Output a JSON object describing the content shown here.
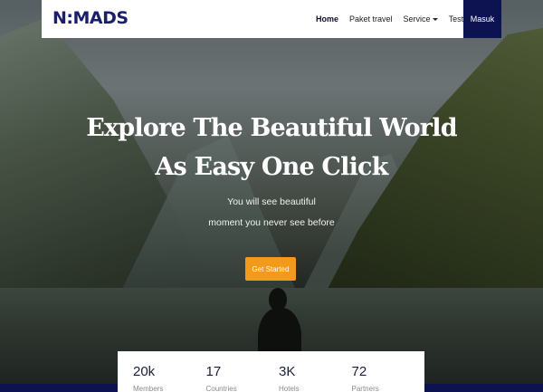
{
  "brand": {
    "logo_text": "N:MADS"
  },
  "nav": {
    "items": [
      {
        "label": "Home",
        "active": true
      },
      {
        "label": "Paket travel",
        "active": false
      },
      {
        "label": "Service",
        "active": false,
        "has_dropdown": true
      },
      {
        "label": "Testimonial",
        "active": false
      }
    ],
    "login_label": "Masuk"
  },
  "hero": {
    "headline_line1": "Explore The Beautiful World",
    "headline_line2": "As Easy One Click",
    "sub_line1": "You will see beautiful",
    "sub_line2": "moment you never see before",
    "cta_label": "Get Started"
  },
  "stats": [
    {
      "value": "20k",
      "label": "Members"
    },
    {
      "value": "17",
      "label": "Countries"
    },
    {
      "value": "3K",
      "label": "Hotels"
    },
    {
      "value": "72",
      "label": "Partners"
    }
  ],
  "colors": {
    "primary": "#0d1250",
    "accent": "#f39a1a",
    "brand_text": "#1b1f6b"
  }
}
